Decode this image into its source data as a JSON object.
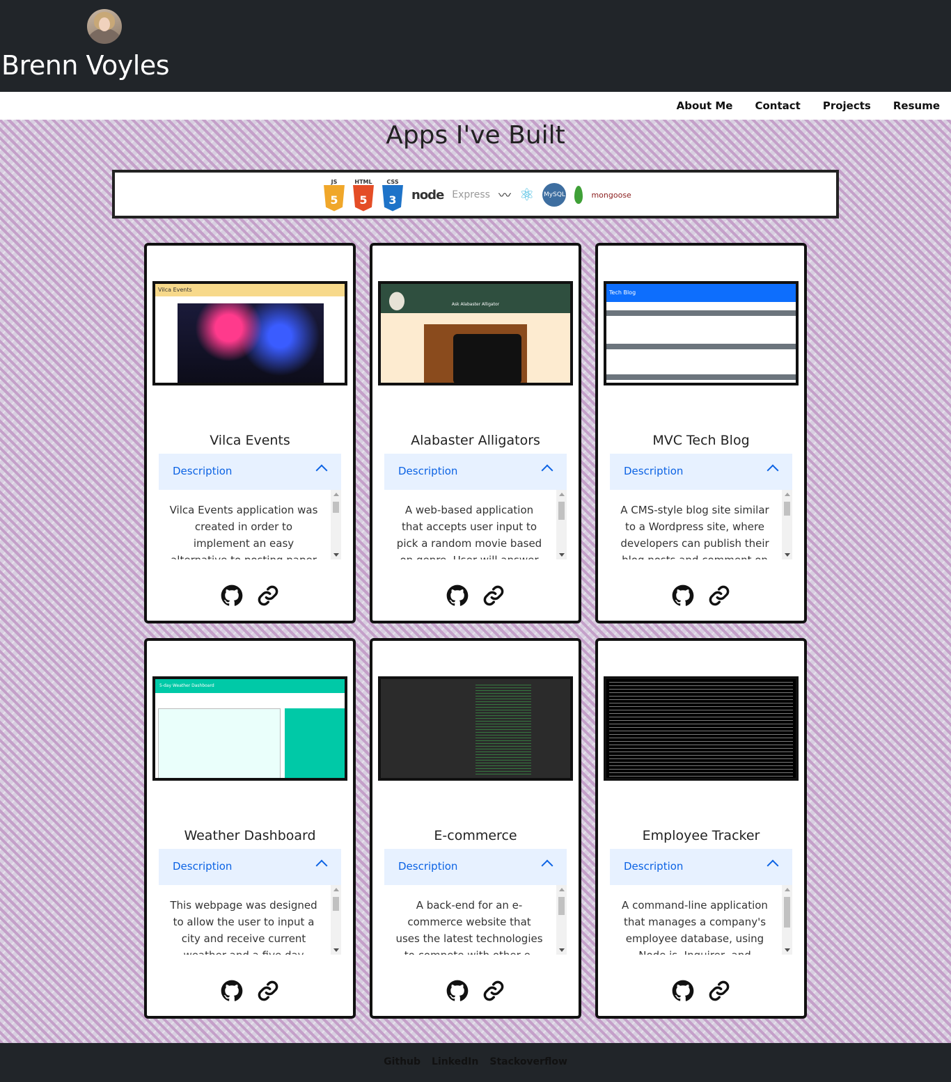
{
  "header": {
    "name": "Brenn Voyles"
  },
  "nav": {
    "items": [
      "About Me",
      "Contact",
      "Projects",
      "Resume"
    ]
  },
  "main": {
    "title": "Apps I've Built",
    "tech": {
      "js": "JS",
      "html": "HTML",
      "css": "CSS",
      "node": "node",
      "express": "Express",
      "mysql": "MySQL",
      "mongoose": "mongoose"
    }
  },
  "projects": [
    {
      "title": "Vilca Events",
      "accordion_label": "Description",
      "description": "Vilca Events application was created in order to implement an easy alternative to posting paper"
    },
    {
      "title": "Alabaster Alligators",
      "accordion_label": "Description",
      "description": "A web-based application that accepts user input to pick a random movie based on genre. User will answer"
    },
    {
      "title": "MVC Tech Blog",
      "accordion_label": "Description",
      "description": "A CMS-style blog site similar to a Wordpress site, where developers can publish their blog posts and comment on"
    },
    {
      "title": "Weather Dashboard",
      "accordion_label": "Description",
      "description": "This webpage was designed to allow the user to input a city and receive current weather and a five day"
    },
    {
      "title": "E-commerce",
      "accordion_label": "Description",
      "description": "A back-end for an e-commerce website that uses the latest technologies to compete with other e-"
    },
    {
      "title": "Employee Tracker",
      "accordion_label": "Description",
      "description": "A command-line application that manages a company's employee database, using Node.js, Inquirer, and"
    }
  ],
  "screens": {
    "vilca_header": "Vilca Events",
    "alli_title": "Ask Alabaster Alligator",
    "blog_header": "Tech Blog",
    "weather_header": "5-day Weather Dashboard"
  },
  "footer": {
    "links": [
      "Github",
      "LinkedIn",
      "Stackoverflow"
    ]
  },
  "colors": {
    "header_bg": "#212529",
    "accordion_bg": "#e7f1ff",
    "accordion_text": "#0c63e4",
    "pattern": "#c4a0c9"
  }
}
